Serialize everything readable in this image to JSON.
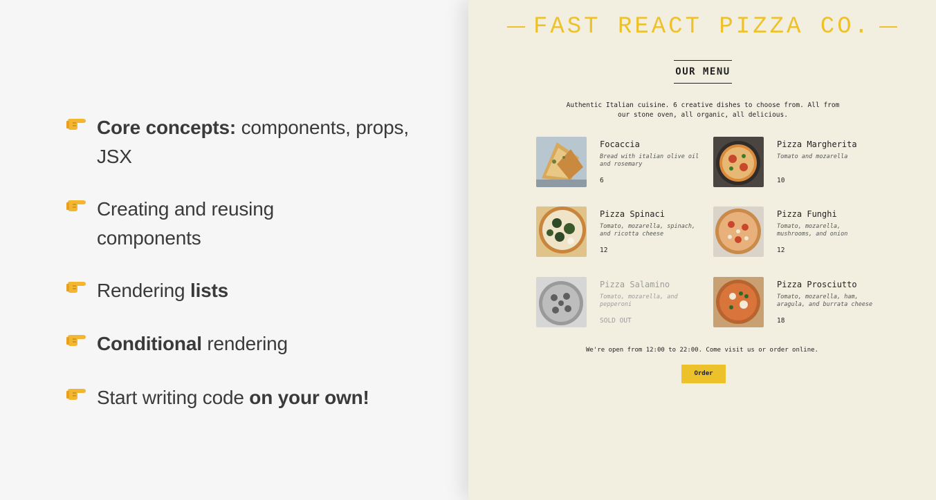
{
  "slide": {
    "bullets": [
      {
        "bold_prefix": "Core concepts:",
        "text_after": " components, props, JSX"
      },
      {
        "text_before": "Creating and reusing components"
      },
      {
        "text_before": "Rendering ",
        "bold_suffix": "lists"
      },
      {
        "bold_prefix": "Conditional",
        "text_after": " rendering"
      },
      {
        "text_before": "Start writing code ",
        "bold_suffix": "on your own!"
      }
    ],
    "bullet_icon": "pointing-hand-icon"
  },
  "app": {
    "title": "FAST REACT PIZZA CO.",
    "menu_heading": "OUR MENU",
    "intro": "Authentic Italian cuisine. 6 creative dishes to choose from. All from our stone oven, all organic, all delicious.",
    "pizzas": [
      {
        "name": "Focaccia",
        "ingredients": "Bread with italian olive oil and rosemary",
        "price": "6"
      },
      {
        "name": "Pizza Margherita",
        "ingredients": "Tomato and mozarella",
        "price": "10"
      },
      {
        "name": "Pizza Spinaci",
        "ingredients": "Tomato, mozarella, spinach, and ricotta cheese",
        "price": "12"
      },
      {
        "name": "Pizza Funghi",
        "ingredients": "Tomato, mozarella, mushrooms, and onion",
        "price": "12"
      },
      {
        "name": "Pizza Salamino",
        "ingredients": "Tomato, mozarella, and pepperoni",
        "price": "SOLD OUT"
      },
      {
        "name": "Pizza Prosciutto",
        "ingredients": "Tomato, mozarella, ham, aragula, and burrata cheese",
        "price": "18"
      }
    ],
    "footer": "We're open from 12:00 to 22:00. Come visit us or order online.",
    "order_button": "Order",
    "colors": {
      "accent": "#edc12a",
      "background": "#f2efe1"
    }
  }
}
